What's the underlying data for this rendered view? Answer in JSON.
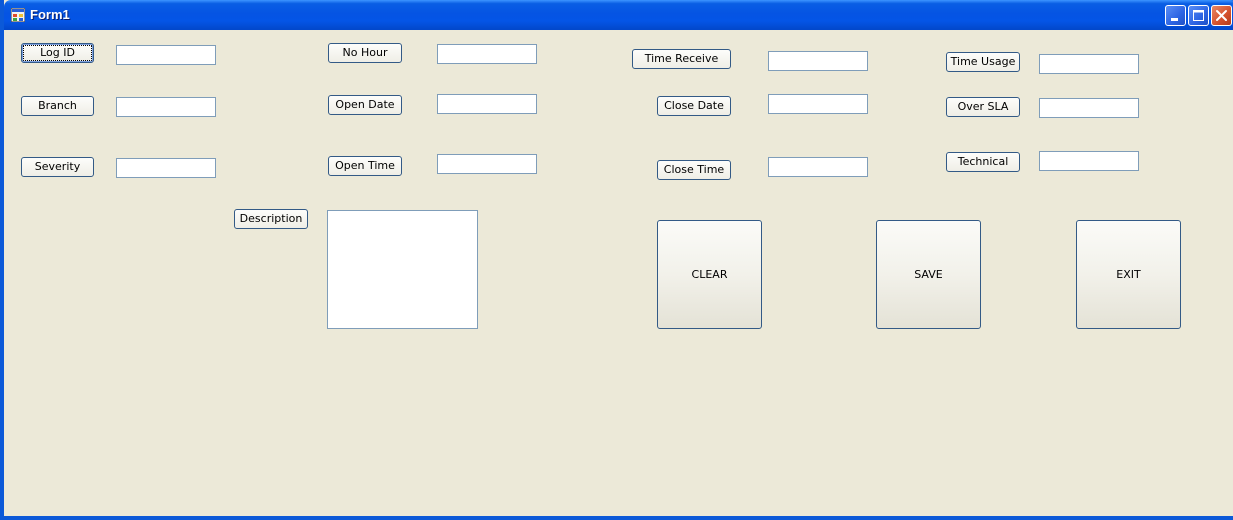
{
  "window": {
    "title": "Form1"
  },
  "labels": {
    "log_id": "Log ID",
    "branch": "Branch",
    "severity": "Severity",
    "no_hour": "No Hour",
    "open_date": "Open Date",
    "open_time": "Open Time",
    "description": "Description",
    "time_receive": "Time Receive",
    "close_date": "Close Date",
    "close_time": "Close Time",
    "time_usage": "Time Usage",
    "over_sla": "Over SLA",
    "technical": "Technical"
  },
  "fields": {
    "log_id": "",
    "branch": "",
    "severity": "",
    "no_hour": "",
    "open_date": "",
    "open_time": "",
    "description": "",
    "time_receive": "",
    "close_date": "",
    "close_time": "",
    "time_usage": "",
    "over_sla": "",
    "technical": ""
  },
  "buttons": {
    "clear": "CLEAR",
    "save": "SAVE",
    "exit": "EXIT"
  },
  "icons": {
    "app": "form-app-icon",
    "minimize": "minimize-icon",
    "maximize": "maximize-icon",
    "close": "close-icon"
  },
  "colors": {
    "titlebar": "#0554e3",
    "client_bg": "#ece9d8",
    "button_border": "#335a86",
    "textbox_border": "#7f9db9",
    "close_button": "#d3502c"
  }
}
